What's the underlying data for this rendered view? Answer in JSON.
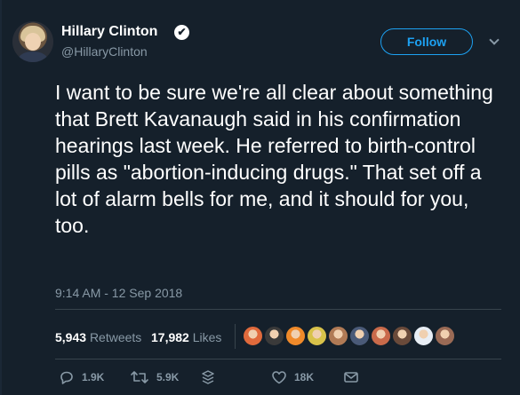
{
  "author": {
    "name": "Hillary Clinton",
    "handle": "@HillaryClinton",
    "verified_glyph": "✔"
  },
  "follow_button": {
    "label": "Follow"
  },
  "tweet": {
    "text": "I want to be sure we're all clear about something that Brett Kavanaugh said in his confirmation hearings last week. He referred to birth-control pills as \"abortion-inducing drugs.\" That set off a lot of alarm bells for me, and it should for you, too.",
    "timestamp": "9:14 AM - 12 Sep 2018"
  },
  "stats": {
    "retweets_count": "5,943",
    "retweets_label": "Retweets",
    "likes_count": "17,982",
    "likes_label": "Likes"
  },
  "liker_avatars": [
    {
      "color": "#e06a3c"
    },
    {
      "color": "#3a3a3a"
    },
    {
      "color": "#f08a2a"
    },
    {
      "color": "#d8c24a"
    },
    {
      "color": "#b07a55"
    },
    {
      "color": "#4a5a78"
    },
    {
      "color": "#c96a4a"
    },
    {
      "color": "#6a4a3a"
    },
    {
      "color": "#e8eef5"
    },
    {
      "color": "#9a6a55"
    }
  ],
  "actions": {
    "reply_count": "1.9K",
    "retweet_count": "5.9K",
    "like_count": "18K"
  },
  "icons": {
    "reply": "reply-icon",
    "retweet": "retweet-icon",
    "stack": "stack-icon",
    "like": "heart-icon",
    "dm": "envelope-icon"
  },
  "colors": {
    "background": "#15202b",
    "accent": "#1da1f2",
    "secondary_text": "#8899a6",
    "divider": "#38444d"
  }
}
